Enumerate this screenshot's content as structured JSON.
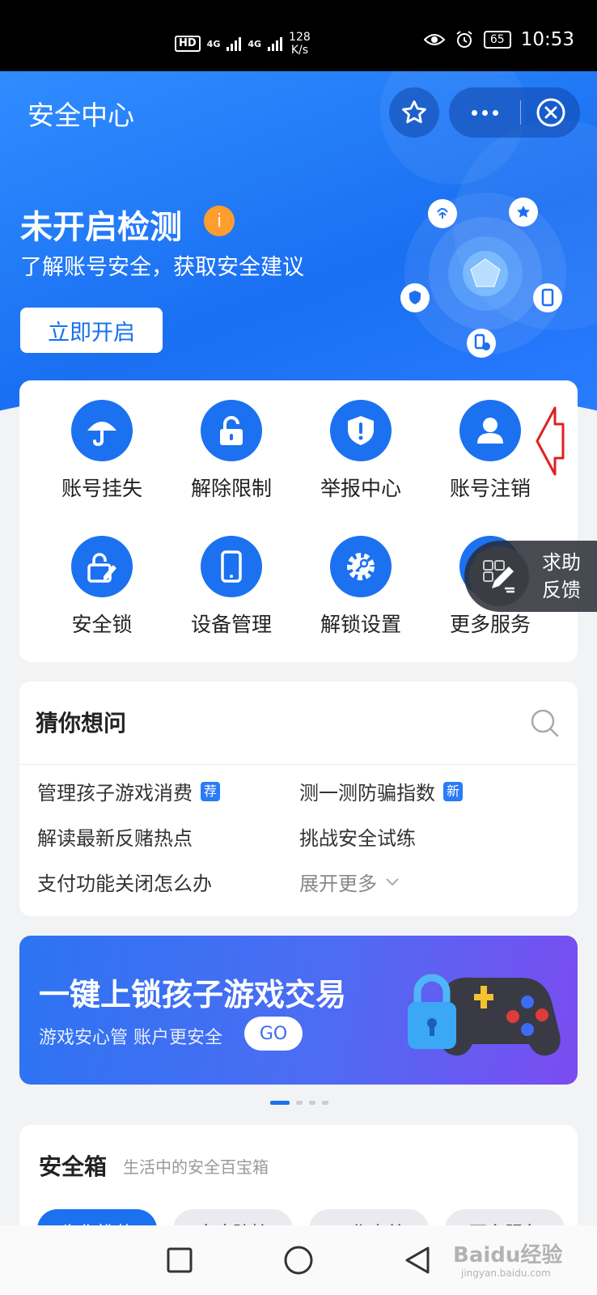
{
  "status_bar": {
    "hd": "HD",
    "net1": "4G",
    "net2": "4G",
    "speed_value": "128",
    "speed_unit": "K/s",
    "battery": "65",
    "time": "10:53"
  },
  "header": {
    "title": "安全中心",
    "hero_title": "未开启检测",
    "info_badge": "i",
    "hero_subtitle": "了解账号安全，获取安全建议",
    "enable_button": "立即开启"
  },
  "services": [
    {
      "label": "账号挂失",
      "icon": "umbrella-icon"
    },
    {
      "label": "解除限制",
      "icon": "unlock-icon"
    },
    {
      "label": "举报中心",
      "icon": "shield-alert-icon"
    },
    {
      "label": "账号注销",
      "icon": "user-icon"
    },
    {
      "label": "安全锁",
      "icon": "lock-edit-icon"
    },
    {
      "label": "设备管理",
      "icon": "phone-icon"
    },
    {
      "label": "解锁设置",
      "icon": "gear-key-icon"
    },
    {
      "label": "更多服务",
      "icon": "grid-icon"
    }
  ],
  "help_float": {
    "line1": "求助",
    "line2": "反馈"
  },
  "guess": {
    "title": "猜你想问",
    "questions": [
      {
        "text": "管理孩子游戏消费",
        "tag": "荐"
      },
      {
        "text": "测一测防骗指数",
        "tag": "新"
      },
      {
        "text": "解读最新反赌热点"
      },
      {
        "text": "挑战安全试练"
      },
      {
        "text": "支付功能关闭怎么办"
      }
    ],
    "more": "展开更多"
  },
  "banner": {
    "title": "一键上锁孩子游戏交易",
    "subtitle": "游戏安心管 账户更安全",
    "go": "GO"
  },
  "safebox": {
    "title": "安全箱",
    "desc": "生活中的安全百宝箱",
    "chips": [
      "为你推荐",
      "家庭防护",
      "工作出差",
      "更多服务"
    ]
  },
  "watermark": {
    "brand": "Baidu经验",
    "site": "jingyan.baidu.com"
  },
  "colors": {
    "primary": "#1b71f0",
    "badge_orange": "#ff9d2e",
    "annotation_red": "#e02020"
  }
}
